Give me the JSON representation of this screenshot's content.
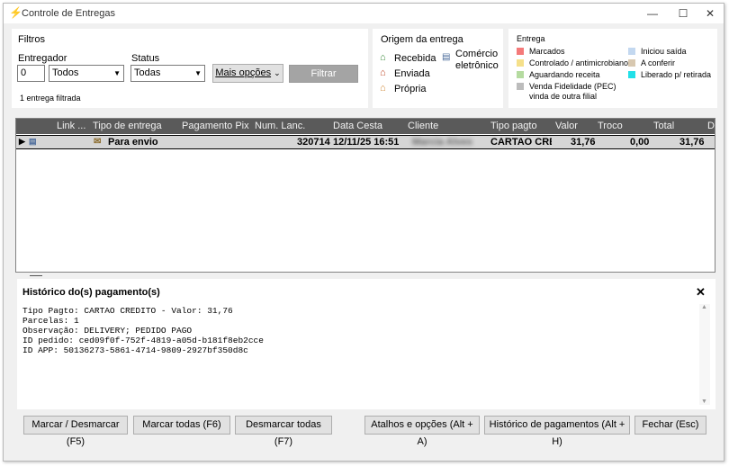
{
  "window": {
    "title": "Controle de Entregas",
    "min": "—",
    "max": "☐",
    "close": "✕"
  },
  "filters": {
    "group_label": "Filtros",
    "entregador_label": "Entregador",
    "entregador_code": "0",
    "entregador_value": "Todos",
    "status_label": "Status",
    "status_value": "Todas",
    "more_options": "Mais opções",
    "filter_button": "Filtrar",
    "filtered_count": "1 entrega filtrada"
  },
  "origin": {
    "group_label": "Origem da entrega",
    "items": [
      "Recebida",
      "Enviada",
      "Própria"
    ],
    "ecommerce_line1": "Comércio",
    "ecommerce_line2": "eletrônico"
  },
  "legend": {
    "group_label": "Entrega",
    "items": [
      {
        "label": "Marcados",
        "color": "#f47a7a"
      },
      {
        "label": "Controlado / antimicrobiano",
        "color": "#f5e08a"
      },
      {
        "label": "Aguardando receita",
        "color": "#b5dba0"
      },
      {
        "label": "Venda Fidelidade (PEC)",
        "label2": "vinda de outra filial",
        "color": "#bcbcbc"
      },
      {
        "label": "Iniciou saída",
        "color": "#c3d8f0"
      },
      {
        "label": "A conferir",
        "color": "#d8c8b0"
      },
      {
        "label": "Liberado p/ retirada",
        "color": "#22e0e8"
      }
    ]
  },
  "grid": {
    "columns": [
      "Link ...",
      "Tipo de entrega",
      "Pagamento Pix",
      "Num. Lanc.",
      "Data Cesta",
      "Cliente",
      "Tipo pagto",
      "Valor",
      "Troco",
      "Total",
      "D"
    ],
    "row": {
      "tipo_entrega": "Para envio",
      "num_lanc": "320714",
      "data_cesta": "12/11/25 16:51",
      "cliente": "Marcia Alves",
      "tipo_pagto": "CARTAO CREI",
      "valor": "31,76",
      "troco": "0,00",
      "total": "31,76"
    }
  },
  "history": {
    "title": "Histórico do(s) pagamento(s)",
    "close": "✕",
    "lines": [
      "Tipo Pagto: CARTAO CREDITO - Valor: 31,76",
      "Parcelas: 1",
      "Observação: DELIVERY; PEDIDO PAGO",
      "ID pedido: ced09f0f-752f-4819-a05d-b181f8eb2cce",
      "ID APP: 50136273-5861-4714-9809-2927bf350d8c"
    ]
  },
  "buttons": {
    "mark": "Marcar / Desmarcar (F5)",
    "mark_all": "Marcar todas (F6)",
    "unmark_all": "Desmarcar todas (F7)",
    "shortcuts": "Atalhos e opções (Alt + A)",
    "payment_history": "Histórico de pagamentos (Alt + H)",
    "close": "Fechar (Esc)"
  }
}
